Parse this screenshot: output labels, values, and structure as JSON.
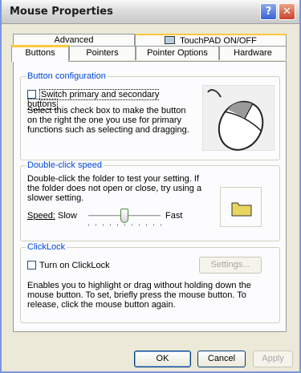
{
  "window": {
    "title": "Mouse Properties",
    "help_label": "?",
    "close_label": "✕"
  },
  "tabs": {
    "back": [
      {
        "label": "Advanced"
      },
      {
        "label": "TouchPAD ON/OFF"
      }
    ],
    "front": [
      {
        "label": "Buttons",
        "active": true
      },
      {
        "label": "Pointers"
      },
      {
        "label": "Pointer Options"
      },
      {
        "label": "Hardware"
      }
    ]
  },
  "button_config": {
    "legend": "Button configuration",
    "checkbox_label": "Switch primary and secondary buttons",
    "checked": false,
    "description": "Select this check box to make the button on the right the one you use for primary functions such as selecting and dragging."
  },
  "double_click": {
    "legend": "Double-click speed",
    "description": "Double-click the folder to test your setting. If the folder does not open or close, try using a slower setting.",
    "speed_label": "Speed:",
    "slow_label": "Slow",
    "fast_label": "Fast",
    "speed_level": 0.5
  },
  "clicklock": {
    "legend": "ClickLock",
    "checkbox_label": "Turn on ClickLock",
    "checked": false,
    "settings_label": "Settings...",
    "description": "Enables you to highlight or drag without holding down the mouse button. To set, briefly press the mouse button. To release, click the mouse button again."
  },
  "footer": {
    "ok_label": "OK",
    "cancel_label": "Cancel",
    "apply_label": "Apply"
  },
  "colors": {
    "accent_tab": "#ffc83c",
    "legend_text": "#0046d5",
    "folder": "#e8d560"
  }
}
